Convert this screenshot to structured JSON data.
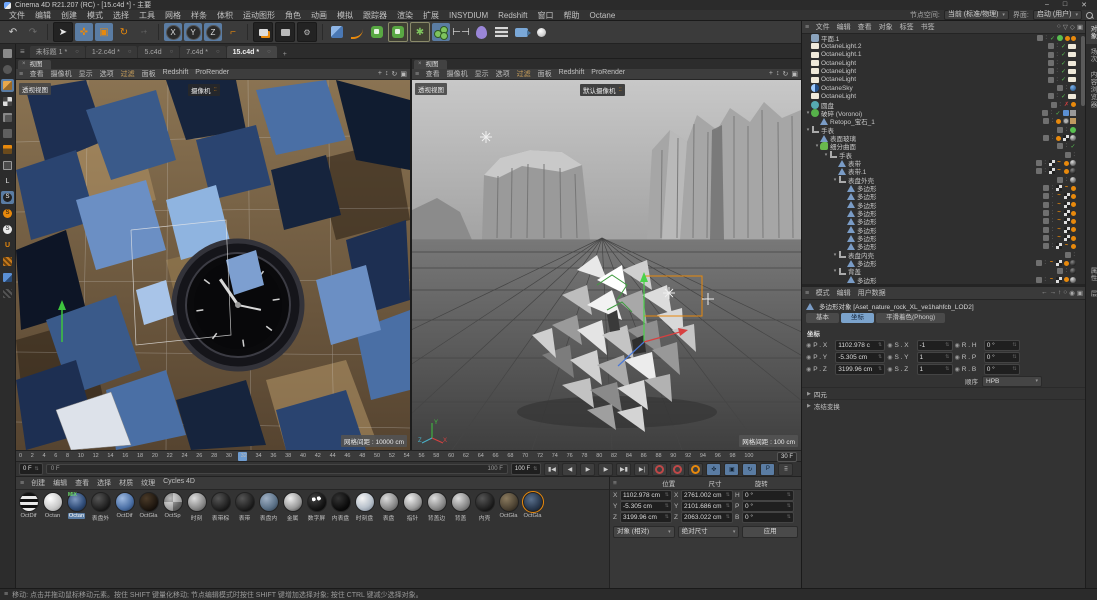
{
  "title_bar": {
    "title": "Cinema 4D R21.207 (RC) - [15.c4d *] - 主要",
    "minimize": "–",
    "maximize": "□",
    "close": "✕"
  },
  "menu_bar": {
    "items": [
      "文件",
      "编辑",
      "创建",
      "模式",
      "选择",
      "工具",
      "网格",
      "样条",
      "体积",
      "运动图形",
      "角色",
      "动画",
      "模拟",
      "跟踪器",
      "渲染",
      "扩展",
      "INSYDIUM",
      "Redshift",
      "窗口",
      "帮助",
      "Octane"
    ],
    "node_space_label": "节点空间:",
    "node_space_value": "当前 (标准/物理)",
    "interface_label": "界面:",
    "interface_value": "启动 (用户)"
  },
  "document_tabs": {
    "tabs": [
      {
        "label": "未标题 1 *",
        "active": false
      },
      {
        "label": "1-2.c4d *",
        "active": false
      },
      {
        "label": "5.c4d",
        "active": false
      },
      {
        "label": "7.c4d *",
        "active": false
      },
      {
        "label": "15.c4d *",
        "active": true
      }
    ],
    "add_label": "+"
  },
  "viewport_left": {
    "tab": "视图",
    "menu": [
      "查看",
      "摄像机",
      "显示",
      "选项",
      "过滤",
      "面板",
      "Redshift",
      "ProRender"
    ],
    "view_label": "透视视图",
    "camera_label": "摄像机",
    "grid_info": "网格间距 : 10000 cm"
  },
  "viewport_right": {
    "tab": "视图",
    "menu": [
      "查看",
      "摄像机",
      "显示",
      "选项",
      "过滤",
      "面板",
      "Redshift",
      "ProRender"
    ],
    "view_label": "透视视图",
    "camera_label": "默认摄像机",
    "grid_info": "网格间距 : 100 cm"
  },
  "timeline": {
    "ticks": [
      0,
      2,
      4,
      6,
      8,
      10,
      12,
      14,
      16,
      18,
      20,
      22,
      24,
      26,
      28,
      30,
      32,
      34,
      36,
      38,
      40,
      42,
      44,
      46,
      48,
      50,
      52,
      54,
      56,
      58,
      60,
      62,
      64,
      66,
      68,
      70,
      72,
      74,
      76,
      78,
      80,
      82,
      84,
      86,
      88,
      90,
      92,
      94,
      96,
      98,
      100
    ],
    "current_frame": 30,
    "current_frame_label": "30 F",
    "start_spinner": "0 F",
    "range_start": "0 F",
    "range_end": "100 F",
    "end_spinner": "100 F"
  },
  "materials": {
    "menu": [
      "创建",
      "编辑",
      "查看",
      "选择",
      "材质",
      "纹理",
      "Cycles 4D"
    ],
    "items": [
      {
        "label": "OctDif",
        "style": "stripes"
      },
      {
        "label": "Octan",
        "style": "white"
      },
      {
        "label": "Octan",
        "style": "bluerock",
        "selected": true,
        "badge": "MIX"
      },
      {
        "label": "表盘外",
        "style": "dark"
      },
      {
        "label": "OctDif",
        "style": "blue"
      },
      {
        "label": "OctGla",
        "style": "darkbrown"
      },
      {
        "label": "OctSp",
        "style": "checker"
      },
      {
        "label": "时刻",
        "style": "grey"
      },
      {
        "label": "表带棕",
        "style": "dark"
      },
      {
        "label": "表带",
        "style": "dark"
      },
      {
        "label": "表盘内",
        "style": "bluegrey"
      },
      {
        "label": "金属",
        "style": "metal"
      },
      {
        "label": "数字屏",
        "style": "dots"
      },
      {
        "label": "内表盘",
        "style": "black"
      },
      {
        "label": "时刻盘",
        "style": "glass"
      },
      {
        "label": "表盘",
        "style": "grey"
      },
      {
        "label": "指针",
        "style": "metal"
      },
      {
        "label": "背盖边",
        "style": "grey"
      },
      {
        "label": "背盖",
        "style": "grey"
      },
      {
        "label": "内壳",
        "style": "dark"
      },
      {
        "label": "OctGla",
        "style": "brown"
      },
      {
        "label": "OctGla",
        "style": "bluerock2",
        "selected_border": true
      }
    ]
  },
  "coordinates_panel": {
    "headers": [
      "位置",
      "尺寸",
      "旋转"
    ],
    "rows": [
      {
        "pos_l": "X",
        "pos_v": "1102.978 cm",
        "size_l": "X",
        "size_v": "2761.002 cm",
        "rot_l": "H",
        "rot_v": "0 °"
      },
      {
        "pos_l": "Y",
        "pos_v": "-5.305 cm",
        "size_l": "Y",
        "size_v": "2101.686 cm",
        "rot_l": "P",
        "rot_v": "0 °"
      },
      {
        "pos_l": "Z",
        "pos_v": "3199.96 cm",
        "size_l": "Z",
        "size_v": "2063.022 cm",
        "rot_l": "B",
        "rot_v": "0 °"
      }
    ],
    "mode_dropdown": "对象 (相对)",
    "size_dropdown": "绝对尺寸",
    "apply_label": "应用"
  },
  "object_manager": {
    "menu": [
      "文件",
      "编辑",
      "查看",
      "对象",
      "标签",
      "书签"
    ],
    "tree": [
      {
        "label": "平面.1",
        "depth": 0,
        "icon": "plane",
        "tags": [
          "check",
          "green",
          "tex",
          "tex"
        ]
      },
      {
        "label": "OctaneLight.2",
        "depth": 0,
        "icon": "light",
        "tags": [
          "check",
          "light"
        ]
      },
      {
        "label": "OctaneLight.1",
        "depth": 0,
        "icon": "light",
        "tags": [
          "check",
          "light"
        ]
      },
      {
        "label": "OctaneLight",
        "depth": 0,
        "icon": "light",
        "tags": [
          "check",
          "light"
        ]
      },
      {
        "label": "OctaneLight",
        "depth": 0,
        "icon": "light",
        "tags": [
          "check",
          "light"
        ]
      },
      {
        "label": "OctaneLight",
        "depth": 0,
        "icon": "light",
        "tags": [
          "check",
          "light"
        ]
      },
      {
        "label": "OctaneSky",
        "depth": 0,
        "icon": "sky",
        "tags": [
          "sky"
        ]
      },
      {
        "label": "OctaneLight",
        "depth": 0,
        "icon": "light",
        "tags": [
          "check",
          "light"
        ]
      },
      {
        "label": "圆盘",
        "depth": 0,
        "icon": "disc",
        "tags": [
          "cross",
          "tex"
        ]
      },
      {
        "label": "破碎 (Voronoi)",
        "depth": 0,
        "icon": "voronoi",
        "expand": true,
        "tags": [
          "check",
          "blue",
          "grid"
        ]
      },
      {
        "label": "Retopo_宝石_1",
        "depth": 1,
        "icon": "poly",
        "tags": [
          "tex",
          "globe",
          "tan"
        ]
      },
      {
        "label": "手表",
        "depth": 0,
        "icon": "null",
        "expand": true,
        "tags": [
          "green"
        ]
      },
      {
        "label": "表面玻璃",
        "depth": 1,
        "icon": "poly",
        "tags": [
          "tex",
          "checker",
          "ball"
        ]
      },
      {
        "label": "细分曲面",
        "depth": 1,
        "icon": "subdiv",
        "expand": true,
        "tags": [
          "check"
        ]
      },
      {
        "label": "手表",
        "depth": 2,
        "icon": "null",
        "expand": true,
        "tags": []
      },
      {
        "label": "表带",
        "depth": 3,
        "icon": "poly",
        "tags": [
          "checker",
          "wave",
          "tex",
          "ball"
        ]
      },
      {
        "label": "表带.1",
        "depth": 3,
        "icon": "poly",
        "tags": [
          "checker",
          "wave",
          "tex",
          "ball2"
        ]
      },
      {
        "label": "表盘外壳",
        "depth": 3,
        "icon": "null",
        "expand": true,
        "tags": [
          "ball"
        ]
      },
      {
        "label": "多边形",
        "depth": 4,
        "icon": "poly",
        "tags": [
          "checker",
          "wave",
          "tex"
        ]
      },
      {
        "label": "多边形",
        "depth": 4,
        "icon": "poly",
        "tags": [
          "wave",
          "checker",
          "tex"
        ]
      },
      {
        "label": "多边形",
        "depth": 4,
        "icon": "poly",
        "tags": [
          "wave",
          "checker",
          "tex"
        ]
      },
      {
        "label": "多边形",
        "depth": 4,
        "icon": "poly",
        "tags": [
          "wave",
          "checker",
          "tex"
        ]
      },
      {
        "label": "多边形",
        "depth": 4,
        "icon": "poly",
        "tags": [
          "wave",
          "checker",
          "tex"
        ]
      },
      {
        "label": "多边形",
        "depth": 4,
        "icon": "poly",
        "tags": [
          "wave",
          "checker",
          "tex"
        ]
      },
      {
        "label": "多边形",
        "depth": 4,
        "icon": "poly",
        "tags": [
          "wave",
          "checker",
          "tex"
        ]
      },
      {
        "label": "多边形",
        "depth": 4,
        "icon": "poly",
        "tags": [
          "checker",
          "wave",
          "tex"
        ]
      },
      {
        "label": "表盘内壳",
        "depth": 3,
        "icon": "null",
        "expand": true,
        "tags": []
      },
      {
        "label": "多边形",
        "depth": 4,
        "icon": "poly",
        "tags": [
          "wave",
          "checker",
          "tex",
          "ball2"
        ]
      },
      {
        "label": "背盖",
        "depth": 3,
        "icon": "null",
        "expand": true,
        "tags": [
          "ball2"
        ]
      },
      {
        "label": "多边形",
        "depth": 4,
        "icon": "poly",
        "tags": [
          "wave",
          "checker",
          "tex",
          "ball"
        ]
      }
    ]
  },
  "attribute_manager": {
    "menu": [
      "模式",
      "编辑",
      "用户数据"
    ],
    "object_title": "多边形对象 [Aset_nature_rock_XL_ve1hahfcb_LOD2]",
    "tabs": [
      "基本",
      "坐标",
      "平滑着色(Phong)"
    ],
    "active_tab": "坐标",
    "section": "坐标",
    "rows": [
      {
        "p_l": "P . X",
        "p_v": "1102.978 c",
        "s_l": "S . X",
        "s_v": "-1",
        "r_l": "R . H",
        "r_v": "0 °"
      },
      {
        "p_l": "P . Y",
        "p_v": "-5.305 cm",
        "s_l": "S . Y",
        "s_v": "1",
        "r_l": "R . P",
        "r_v": "0 °"
      },
      {
        "p_l": "P . Z",
        "p_v": "3199.96 cm",
        "s_l": "S . Z",
        "s_v": "1",
        "r_l": "R . B",
        "r_v": "0 °"
      }
    ],
    "order_label": "顺序",
    "order_value": "HPB",
    "collapsed_sections": [
      "四元",
      "冻结变换"
    ]
  },
  "side_tabs": {
    "top": [
      "对象",
      "场次",
      "内容浏览器"
    ],
    "bottom": [
      "属性",
      "层"
    ]
  },
  "status_bar": {
    "text": "移动: 点击并拖动鼠标移动元素。按住 SHIFT 键量化移动; 节点编辑模式时按住 SHIFT 键增加选择对象; 按住 CTRL 键减少选择对象。"
  },
  "colors": {
    "accent_orange": "#e8890c",
    "highlight_blue": "#5a7ca3",
    "check_green": "#58c050"
  }
}
